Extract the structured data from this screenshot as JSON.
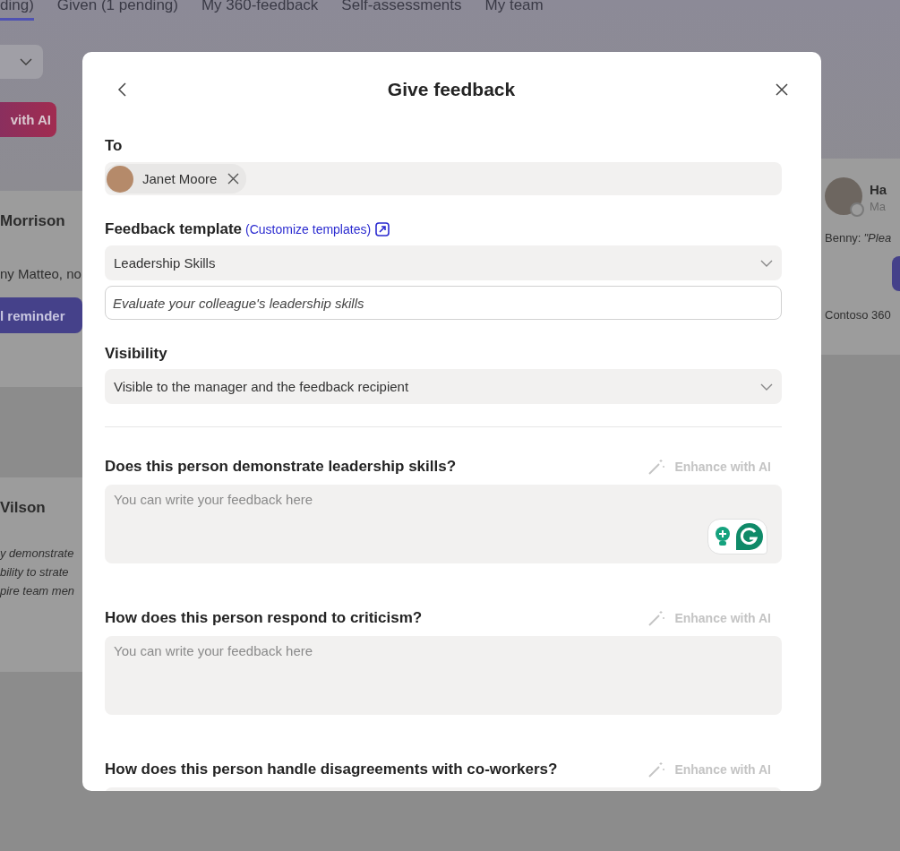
{
  "background": {
    "tabs": [
      {
        "label": "ding)",
        "selected": true
      },
      {
        "label": "Given (1 pending)",
        "selected": false
      },
      {
        "label": "My 360-feedback",
        "selected": false
      },
      {
        "label": "Self-assessments",
        "selected": false
      },
      {
        "label": "My team",
        "selected": false
      }
    ],
    "ai_button": "vith AI",
    "left_cards": [
      {
        "name": "Morrison",
        "text": "ny Matteo, no",
        "button": "l reminder"
      },
      {
        "name": "Vilson",
        "quote": [
          "y demonstrate",
          "bility to strate",
          "pire team men"
        ]
      }
    ],
    "right_card": {
      "name": "Ha",
      "role": "Ma",
      "sender": "Benny:",
      "message": "\"Plea",
      "footer": "Contoso 360"
    }
  },
  "dialog": {
    "title": "Give feedback",
    "to": {
      "label": "To",
      "recipients": [
        {
          "name": "Janet Moore"
        }
      ]
    },
    "template": {
      "label": "Feedback template",
      "link": "(Customize templates)",
      "value": "Leadership Skills",
      "description": "Evaluate your colleague's leadership skills"
    },
    "visibility": {
      "label": "Visibility",
      "value": "Visible to the manager and the feedback recipient"
    },
    "questions": [
      {
        "label": "Does this person demonstrate leadership skills?",
        "enhance": "Enhance with AI",
        "enhance_disabled": true,
        "placeholder": "You can write your feedback here",
        "writing_assistant": true
      },
      {
        "label": "How does this person respond to criticism?",
        "enhance": "Enhance with AI",
        "enhance_disabled": true,
        "placeholder": "You can write your feedback here",
        "writing_assistant": false
      },
      {
        "label": "How does this person handle disagreements with co-workers?",
        "enhance": "Enhance with AI",
        "enhance_disabled": true
      }
    ]
  }
}
